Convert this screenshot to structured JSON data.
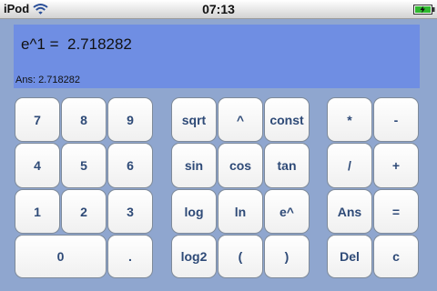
{
  "status_bar": {
    "carrier": "iPod",
    "time": "07:13",
    "wifi_icon": "wifi-icon",
    "battery_icon": "battery-charging-icon"
  },
  "display": {
    "expression": "e^1 =  2.718282",
    "answer_line": "Ans: 2.718282"
  },
  "keys": {
    "digit_7": "7",
    "digit_8": "8",
    "digit_9": "9",
    "digit_4": "4",
    "digit_5": "5",
    "digit_6": "6",
    "digit_1": "1",
    "digit_2": "2",
    "digit_3": "3",
    "digit_0": "0",
    "decimal": ".",
    "sqrt": "sqrt",
    "power": "^",
    "const": "const",
    "sin": "sin",
    "cos": "cos",
    "tan": "tan",
    "log": "log",
    "ln": "ln",
    "exp": "e^",
    "log2": "log2",
    "open_paren": "(",
    "close_paren": ")",
    "multiply": "*",
    "subtract": "-",
    "divide": "/",
    "add": "+",
    "ans": "Ans",
    "equals": "=",
    "delete": "Del",
    "clear": "c"
  },
  "colors": {
    "background": "#8fa6cf",
    "display": "#6f8ee3",
    "key_text": "#2e4a77",
    "key_face": "#ffffff"
  }
}
